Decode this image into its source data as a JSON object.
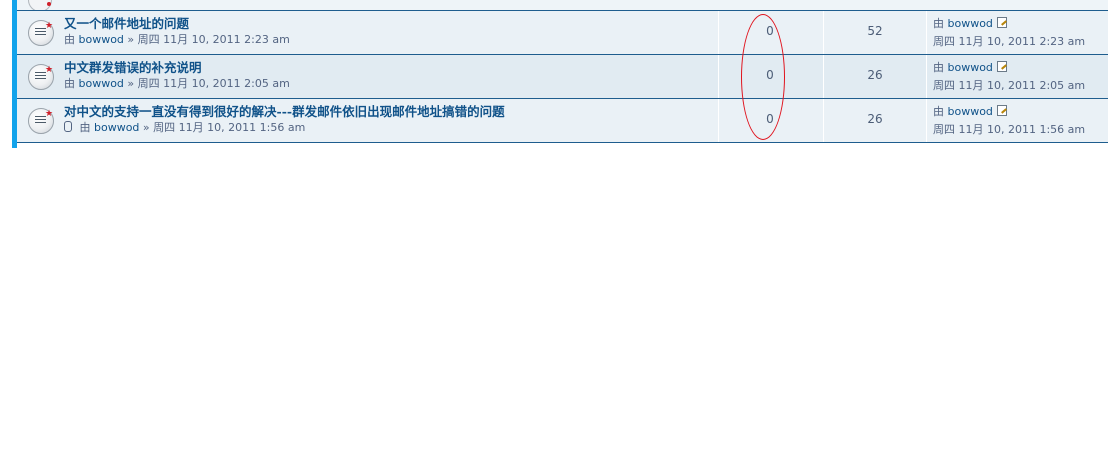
{
  "topics": [
    {
      "title": "又一个邮件地址的问题",
      "by": "由",
      "author": "bowwod",
      "separator": "»",
      "date": "周四 11月 10, 2011 2:23 am",
      "replies": "0",
      "views": "52",
      "last_by": "由",
      "last_author": "bowwod",
      "last_date": "周四 11月 10, 2011 2:23 am"
    },
    {
      "title": "中文群发错误的补充说明",
      "by": "由",
      "author": "bowwod",
      "separator": "»",
      "date": "周四 11月 10, 2011 2:05 am",
      "replies": "0",
      "views": "26",
      "last_by": "由",
      "last_author": "bowwod",
      "last_date": "周四 11月 10, 2011 2:05 am"
    },
    {
      "title": "对中文的支持一直没有得到很好的解决---群发邮件依旧出现邮件地址搞错的问题",
      "by": "由",
      "author": "bowwod",
      "separator": "»",
      "date": "周四 11月 10, 2011 1:56 am",
      "replies": "0",
      "views": "26",
      "last_by": "由",
      "last_author": "bowwod",
      "last_date": "周四 11月 10, 2011 1:56 am"
    }
  ],
  "icons": {
    "topic": "unread-topic-icon",
    "attachment": "paperclip-icon",
    "view_latest": "view-latest-post-icon"
  },
  "colors": {
    "accent": "#12a3eb",
    "link": "#105289",
    "annotation": "#e0141e"
  }
}
